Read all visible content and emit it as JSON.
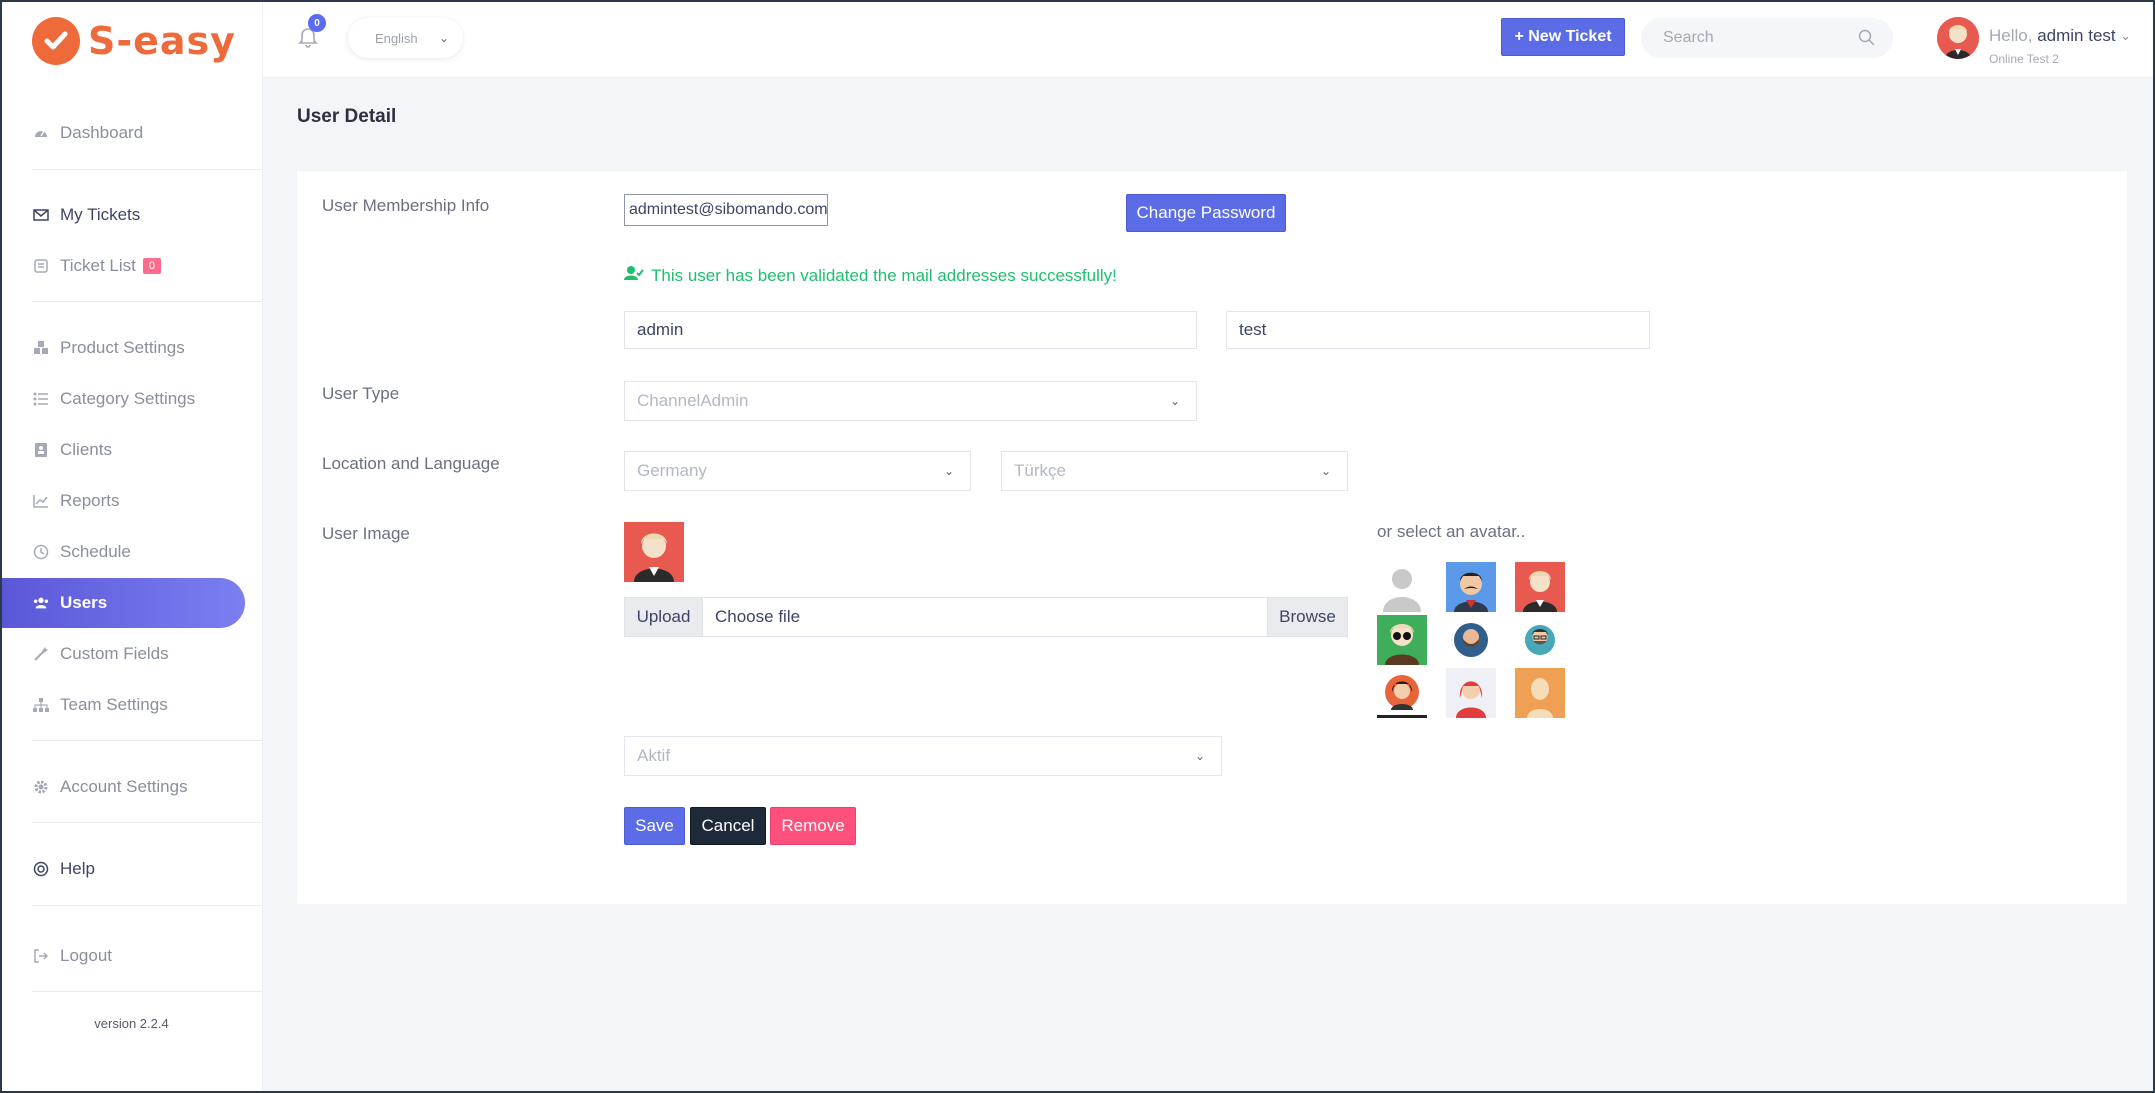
{
  "brand": {
    "name": "S-easy",
    "color": "#ef6a3b"
  },
  "sidebar": {
    "items": [
      {
        "label": "Dashboard",
        "icon": "gauge-icon"
      },
      {
        "label": "My Tickets",
        "icon": "envelope-icon"
      },
      {
        "label": "Ticket List",
        "icon": "ticket-list-icon",
        "badge": "0"
      },
      {
        "label": "Product Settings",
        "icon": "cubes-icon"
      },
      {
        "label": "Category Settings",
        "icon": "list-icon"
      },
      {
        "label": "Clients",
        "icon": "address-book-icon"
      },
      {
        "label": "Reports",
        "icon": "chart-icon"
      },
      {
        "label": "Schedule",
        "icon": "clock-icon"
      },
      {
        "label": "Users",
        "icon": "users-icon",
        "active": true
      },
      {
        "label": "Custom Fields",
        "icon": "magic-wand-icon"
      },
      {
        "label": "Team Settings",
        "icon": "sitemap-icon"
      },
      {
        "label": "Account Settings",
        "icon": "gear-icon"
      },
      {
        "label": "Help",
        "icon": "life-ring-icon"
      },
      {
        "label": "Logout",
        "icon": "logout-icon"
      }
    ],
    "version": "version 2.2.4"
  },
  "header": {
    "notification_count": "0",
    "language": "English",
    "new_ticket_label": "+ New Ticket",
    "search_placeholder": "Search",
    "hello_prefix": "Hello,",
    "user_name": "admin test",
    "user_status": "Online Test 2"
  },
  "page": {
    "title": "User Detail",
    "labels": {
      "membership": "User Membership Info",
      "user_type": "User Type",
      "location_language": "Location and Language",
      "user_image": "User Image"
    },
    "email": "admintest@sibomando.com",
    "change_password": "Change Password",
    "validated_message": "This user has been validated the mail addresses successfully!",
    "first_name": "admin",
    "last_name": "test",
    "user_type": "ChannelAdmin",
    "country": "Germany",
    "language": "Türkçe",
    "upload_label": "Upload",
    "choose_file": "Choose file",
    "browse_label": "Browse",
    "avatar_title": "or select an avatar..",
    "status": "Aktif",
    "save": "Save",
    "cancel": "Cancel",
    "remove": "Remove"
  },
  "colors": {
    "accent": "#5b6ce6",
    "success": "#1fbf6f",
    "danger": "#ff4f7b",
    "dark_button": "#1e2a3a"
  }
}
